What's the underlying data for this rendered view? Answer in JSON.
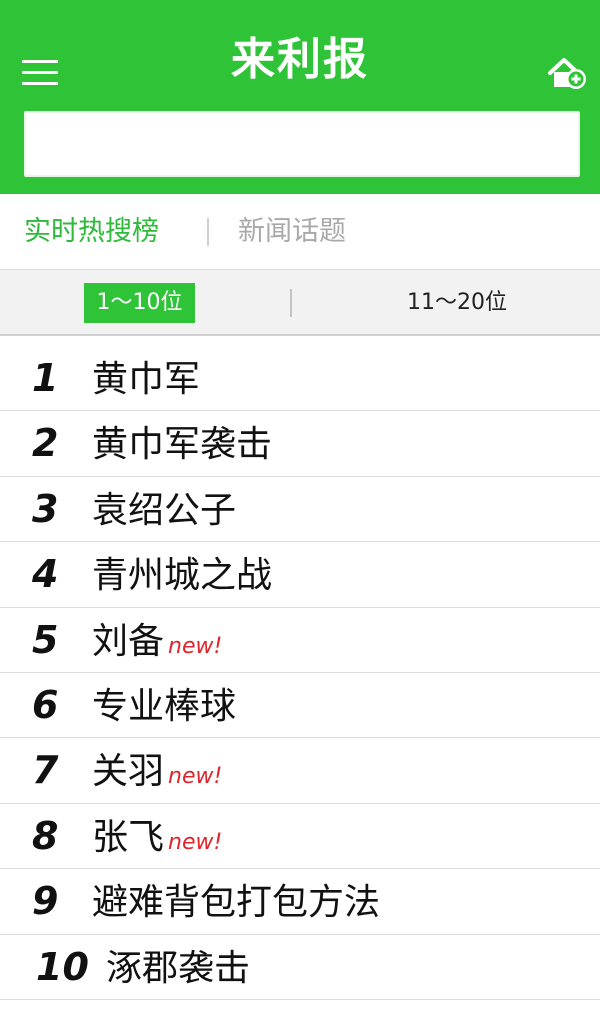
{
  "header": {
    "title": "来利报",
    "menu_icon": "menu-icon",
    "home_add_icon": "home-add-icon",
    "search": {
      "value": "",
      "placeholder": ""
    }
  },
  "category_tabs": [
    {
      "label": "实时热搜榜",
      "active": true
    },
    {
      "label": "新闻话题",
      "active": false
    }
  ],
  "range_tabs": [
    {
      "label": "1～10位",
      "active": true
    },
    {
      "label": "11～20位",
      "active": false
    }
  ],
  "rankings": [
    {
      "rank": "1",
      "text": "黄巾军",
      "badge": ""
    },
    {
      "rank": "2",
      "text": "黄巾军袭击",
      "badge": ""
    },
    {
      "rank": "3",
      "text": "袁绍公子",
      "badge": ""
    },
    {
      "rank": "4",
      "text": "青州城之战",
      "badge": ""
    },
    {
      "rank": "5",
      "text": "刘备",
      "badge": "new!"
    },
    {
      "rank": "6",
      "text": "专业棒球",
      "badge": ""
    },
    {
      "rank": "7",
      "text": "关羽",
      "badge": "new!"
    },
    {
      "rank": "8",
      "text": "张飞",
      "badge": "new!"
    },
    {
      "rank": "9",
      "text": "避难背包打包方法",
      "badge": ""
    },
    {
      "rank": "10",
      "text": "涿郡袭击",
      "badge": ""
    }
  ],
  "colors": {
    "brand_green": "#2fc337",
    "active_tab_text": "#2fb93a",
    "inactive_tab_text": "#a9a9a9",
    "new_badge": "#e0242a"
  }
}
